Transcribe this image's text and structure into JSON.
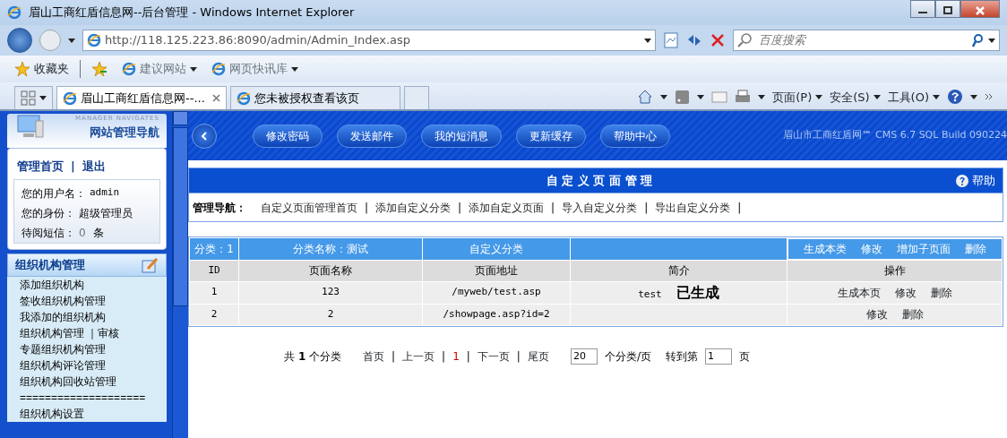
{
  "window": {
    "title": "眉山工商红盾信息网--后台管理 - Windows Internet Explorer"
  },
  "address": {
    "url": "http://118.125.223.86:8090/admin/Admin_Index.asp"
  },
  "search": {
    "placeholder": "百度搜索"
  },
  "favorites": {
    "label": "收藏夹",
    "items": [
      "建议网站",
      "网页快讯库"
    ]
  },
  "tabs": [
    {
      "label": "眉山工商红盾信息网--...",
      "selected": true
    },
    {
      "label": "您未被授权查看该页",
      "selected": false
    }
  ],
  "command_bar": [
    "页面(P)",
    "安全(S)",
    "工具(O)"
  ],
  "separator": "|",
  "sidebar": {
    "caption": "MANAGER NAVIGATES",
    "title": "网站管理导航",
    "links": [
      "管理首页",
      "退出"
    ],
    "info": [
      {
        "label": "您的用户名：",
        "value": "admin"
      },
      {
        "label": "您的身份：",
        "value": "超级管理员"
      },
      {
        "label": "待阅短信：",
        "value": "0",
        "unit": "条"
      }
    ],
    "section": {
      "title": "组织机构管理",
      "items": [
        "添加组织机构",
        "签收组织机构管理",
        "我添加的组织机构",
        "组织机构管理 ｜审核",
        "专题组织机构管理",
        "组织机构评论管理",
        "组织机构回收站管理",
        "====================",
        "组织机构设置"
      ]
    }
  },
  "banner": {
    "buttons": [
      "修改密码",
      "发送邮件",
      "我的短消息",
      "更新缓存",
      "帮助中心"
    ],
    "brand": "眉山市工商红盾网℠ CMS 6.7 SQL Build 090224"
  },
  "panel": {
    "title": "自 定 义 页 面 管 理",
    "help": "帮助",
    "nav_label": "管理导航：",
    "nav_links": [
      "自定义页面管理首页",
      "添加自定义分类",
      "添加自定义页面",
      "导入自定义分类",
      "导出自定义分类"
    ]
  },
  "table": {
    "category": {
      "id": "分类：1",
      "name": "分类名称：测试",
      "type": "自定义分类",
      "actions": [
        "生成本类",
        "修改",
        "增加子页面",
        "删除"
      ]
    },
    "columns": [
      "ID",
      "页面名称",
      "页面地址",
      "简介",
      "操作"
    ],
    "rows": [
      {
        "id": "1",
        "name": "123",
        "url": "/myweb/test.asp",
        "summary": "test",
        "status": "已生成",
        "actions": [
          "生成本页",
          "修改",
          "删除"
        ]
      },
      {
        "id": "2",
        "name": "2",
        "url": "/showpage.asp?id=2",
        "actions": [
          "修改",
          "删除"
        ]
      }
    ]
  },
  "pagination": {
    "total": "共 **1** 个分类",
    "links": [
      {
        "label": "首页",
        "selected": false
      },
      {
        "label": "上一页",
        "selected": false
      },
      {
        "label": "1",
        "selected": true
      },
      {
        "label": "下一页",
        "selected": false
      },
      {
        "label": "尾页",
        "selected": false
      }
    ],
    "per_page": "20",
    "per_page_label": "个分类/页",
    "goto_label": "转到第",
    "goto_page": "1",
    "page_label": "页"
  }
}
